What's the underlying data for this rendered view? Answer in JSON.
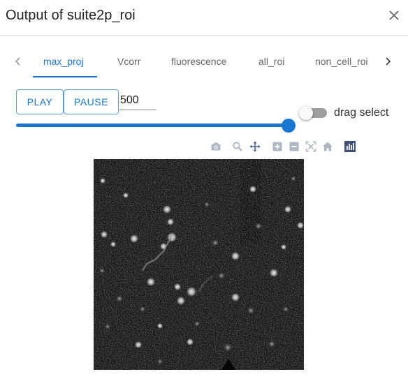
{
  "window": {
    "title": "Output of suite2p_roi"
  },
  "tabs": [
    {
      "label": "max_proj",
      "active": true
    },
    {
      "label": "Vcorr",
      "active": false
    },
    {
      "label": "fluorescence",
      "active": false
    },
    {
      "label": "all_roi",
      "active": false
    },
    {
      "label": "non_cell_roi",
      "active": false
    }
  ],
  "controls": {
    "play_label": "PLAY",
    "pause_label": "PAUSE",
    "frame_value": "500",
    "slider_level": 1.0,
    "drag_select_label": "drag select",
    "drag_select_on": false
  },
  "toolbar": {
    "icons": [
      "camera-icon",
      "zoom-icon",
      "pan-icon",
      "zoom-in-icon",
      "zoom-out-icon",
      "autoscale-icon",
      "reset-axes-icon",
      "plotly-logo-icon"
    ]
  },
  "colors": {
    "accent": "#1976d2",
    "inactive_tab": "#666666",
    "toolbar_icon": "#b0b8c4",
    "image_background": "#101010"
  }
}
